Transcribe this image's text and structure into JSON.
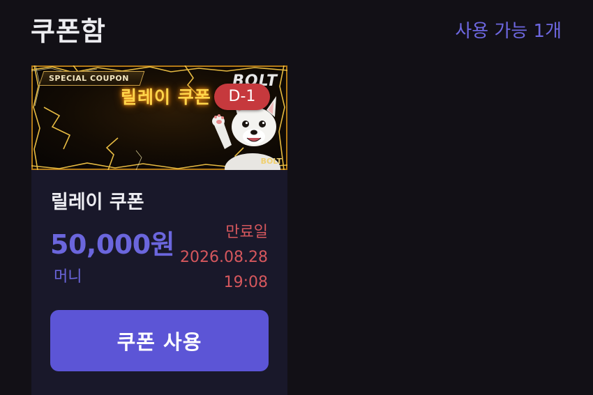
{
  "header": {
    "title": "쿠폰함",
    "available_count": "사용 가능 1개"
  },
  "coupons": [
    {
      "banner": {
        "tag": "SPECIAL COUPON",
        "title": "릴레이 쿠폰",
        "brand": "BOLT",
        "brand_small": "BOLT"
      },
      "dday": "D-1",
      "name": "릴레이 쿠폰",
      "amount": "50,000원",
      "currency": "머니",
      "expiry_label": "만료일",
      "expiry_date": "2026.08.28",
      "expiry_time": "19:08",
      "button_label": "쿠폰 사용"
    }
  ],
  "colors": {
    "background": "#121016",
    "card": "#19182a",
    "accent": "#5c55d6",
    "amount": "#6b66dd",
    "expiry": "#d5575d",
    "badge": "#c6393d"
  }
}
